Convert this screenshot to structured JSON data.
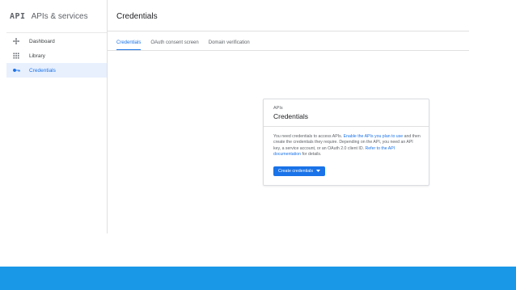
{
  "brand": {
    "logo": "API",
    "title": "APIs & services"
  },
  "sidebar": {
    "items": [
      {
        "label": "Dashboard",
        "icon": "dashboard-icon",
        "active": false
      },
      {
        "label": "Library",
        "icon": "library-icon",
        "active": false
      },
      {
        "label": "Credentials",
        "icon": "key-icon",
        "active": true
      }
    ]
  },
  "header": {
    "title": "Credentials"
  },
  "tabs": [
    {
      "label": "Credentials",
      "active": true
    },
    {
      "label": "OAuth consent screen",
      "active": false
    },
    {
      "label": "Domain verification",
      "active": false
    }
  ],
  "card": {
    "kicker": "APIs",
    "title": "Credentials",
    "text_1": "You need credentials to access APIs.",
    "link_1": "Enable the APIs you plan to use",
    "text_2": "and then create the credentials they require. Depending on the API, you need an API key, a service account, or an OAuth 2.0 client ID.",
    "link_2": "Refer to the API documentation",
    "text_3": "for details.",
    "button_label": "Create credentials"
  },
  "colors": {
    "accent": "#1a73e8",
    "active_bg": "#e8f0fe",
    "bottom_band": "#1a98e8"
  }
}
